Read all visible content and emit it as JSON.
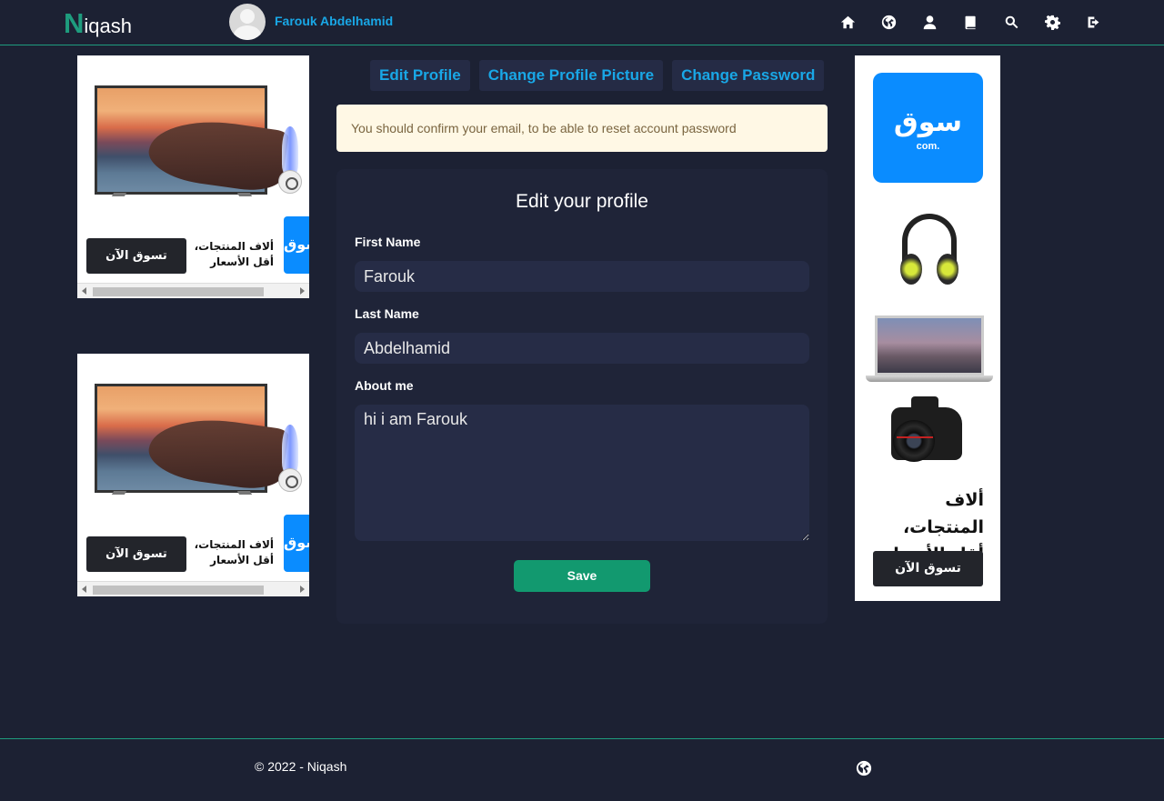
{
  "header": {
    "logo_first_letter": "N",
    "logo_rest": "iqash",
    "username": "Farouk Abdelhamid",
    "nav_icons": [
      "home-icon",
      "globe-icon",
      "user-icon",
      "book-icon",
      "search-icon",
      "gear-icon",
      "logout-icon"
    ]
  },
  "tabs": [
    {
      "label": "Edit Profile"
    },
    {
      "label": "Change Profile Picture"
    },
    {
      "label": "Change Password"
    }
  ],
  "alert": {
    "text": "You should confirm your email, to be able to reset account password"
  },
  "form": {
    "title": "Edit your profile",
    "first_name_label": "First Name",
    "first_name_value": "Farouk",
    "last_name_label": "Last Name",
    "last_name_value": "Abdelhamid",
    "about_label": "About me",
    "about_value": "hi i am Farouk",
    "save_label": "Save"
  },
  "ads": {
    "brand": "سوق",
    "brand_sub": "com.",
    "tagline_line1": "ألاف المنتجات،",
    "tagline_line2": "أقل الأسعار",
    "cta": "تسوق الآن"
  },
  "footer": {
    "copyright": "© 2022 - Niqash"
  },
  "colors": {
    "background": "#1c2133",
    "accent": "#1e9c7e",
    "link": "#19a7e6",
    "card": "#1f2438",
    "input": "#262c46",
    "save_button": "#12996f",
    "alert_bg": "#fff8e5",
    "souq_blue": "#0a8cff"
  }
}
